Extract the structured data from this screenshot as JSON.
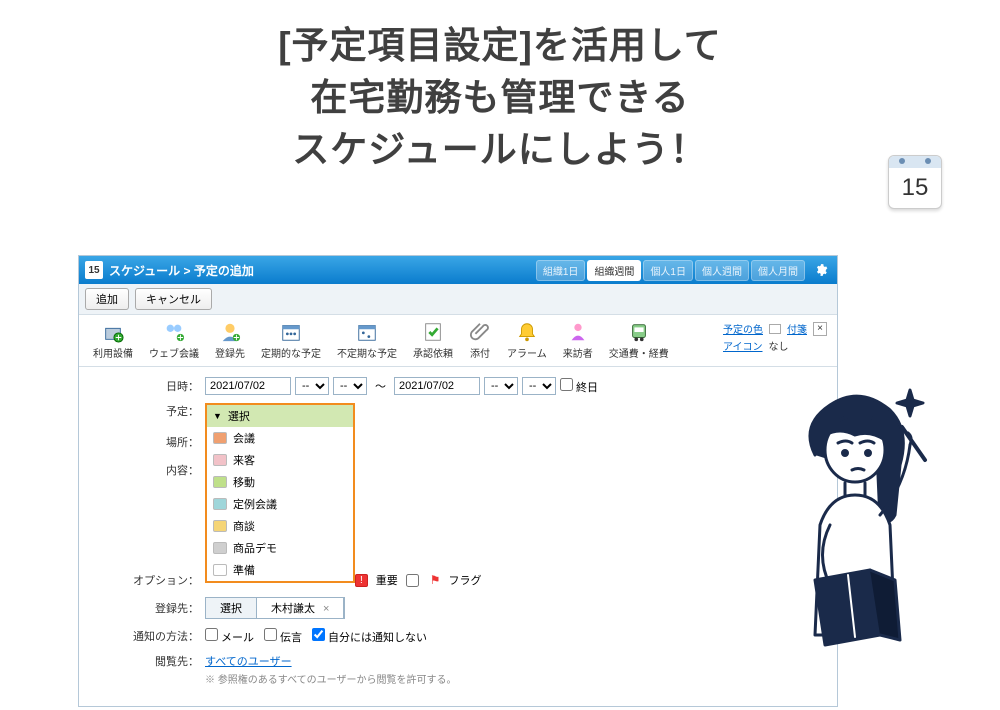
{
  "headline": {
    "line1": "[予定項目設定]を活用して",
    "line2": "在宅勤務も管理できる",
    "line3": "スケジュールにしよう！"
  },
  "calendar_emoji": "15",
  "app": {
    "title_icon_number": "15",
    "breadcrumb": "スケジュール > 予定の追加",
    "view_buttons": [
      {
        "label": "組織1日",
        "active": false
      },
      {
        "label": "組織週間",
        "active": true
      },
      {
        "label": "個人1日",
        "active": false
      },
      {
        "label": "個人週間",
        "active": false
      },
      {
        "label": "個人月間",
        "active": false
      }
    ],
    "subbar": {
      "add": "追加",
      "cancel": "キャンセル"
    },
    "toolbar": [
      {
        "name": "facility",
        "label": "利用設備"
      },
      {
        "name": "webmtg",
        "label": "ウェブ会議"
      },
      {
        "name": "register",
        "label": "登録先"
      },
      {
        "name": "recurring",
        "label": "定期的な予定"
      },
      {
        "name": "irregular",
        "label": "不定期な予定"
      },
      {
        "name": "approval",
        "label": "承認依頼"
      },
      {
        "name": "attach",
        "label": "添付"
      },
      {
        "name": "alarm",
        "label": "アラーム"
      },
      {
        "name": "visitor",
        "label": "来訪者"
      },
      {
        "name": "transport",
        "label": "交通費・経費"
      }
    ],
    "toolbar_right": {
      "color_label_link": "予定の色",
      "attach_link": "付箋",
      "icon_label": "アイコン",
      "icon_value": "なし"
    },
    "form": {
      "datetime_label": "日時：",
      "start_date": "2021/07/02",
      "end_date": "2021/07/02",
      "time_blank": "--",
      "tilde": "～",
      "allday_label": "終日",
      "allday_checked": false,
      "yotei_label": "予定：",
      "yotei_selected": "▼選択",
      "dropdown": [
        {
          "label": "▼選択",
          "color": null,
          "header": true
        },
        {
          "label": "会議",
          "color": "#f0a070"
        },
        {
          "label": "来客",
          "color": "#f2c2c8"
        },
        {
          "label": "移動",
          "color": "#bfe08a"
        },
        {
          "label": "定例会議",
          "color": "#9fd6da"
        },
        {
          "label": "商談",
          "color": "#f5d577"
        },
        {
          "label": "商品デモ",
          "color": "#cfcfcf"
        },
        {
          "label": "準備",
          "color": "#ffffff"
        }
      ],
      "place_label": "場所：",
      "content_label": "内容：",
      "option_label": "オプション：",
      "important_badge": "重要",
      "flag_label": "フラグ",
      "register_to_label": "登録先：",
      "tabs": [
        {
          "label": "選択",
          "active": false
        },
        {
          "label": "木村謙太",
          "active": true,
          "closable": true
        }
      ],
      "notify_label": "通知の方法：",
      "notify_mail": "メール",
      "notify_dengon": "伝言",
      "notify_self_label": "自分には通知しない",
      "notify_self_checked": true,
      "viewers_label": "閲覧先：",
      "viewers_link": "すべてのユーザー",
      "viewers_hint": "※ 参照権のあるすべてのユーザーから閲覧を許可する。"
    }
  }
}
